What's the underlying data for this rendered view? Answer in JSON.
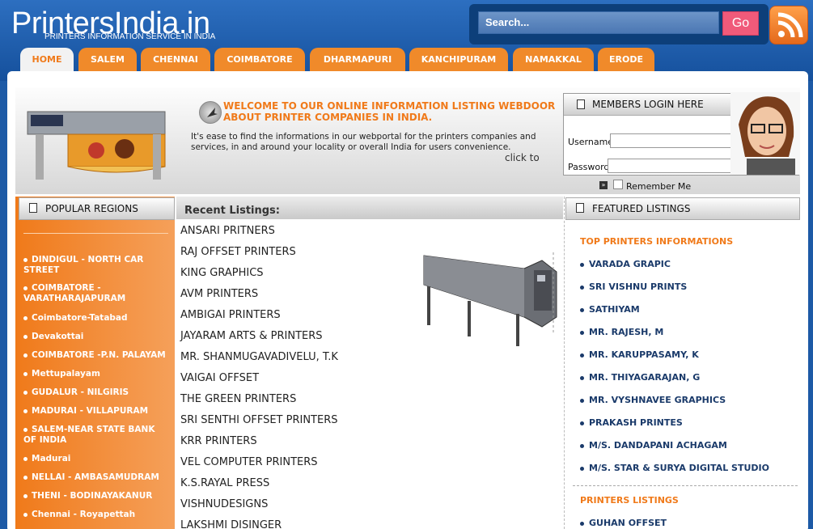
{
  "header": {
    "logo": "PrintersIndia.in",
    "tagline": "PRINTERS INFORMATION SERVICE IN INDIA",
    "search_placeholder": "Search...",
    "go_label": "Go"
  },
  "tabs": [
    {
      "label": "HOME",
      "active": true
    },
    {
      "label": "SALEM"
    },
    {
      "label": "CHENNAI"
    },
    {
      "label": "COIMBATORE"
    },
    {
      "label": "DHARMAPURI"
    },
    {
      "label": "KANCHIPURAM"
    },
    {
      "label": "NAMAKKAL"
    },
    {
      "label": "ERODE"
    }
  ],
  "welcome": {
    "title": "WELCOME TO OUR ONLINE INFORMATION LISTING WEBDOOR ABOUT PRINTER COMPANIES IN INDIA.",
    "text": "It's ease to find the informations in our webportal for the printers companies and services, in and around your locality or overall India for users convenience.",
    "click_to": "click to"
  },
  "login": {
    "title": "MEMBERS LOGIN HERE",
    "username_label": "Username",
    "password_label": "Password",
    "remember_label": "Remember Me"
  },
  "regions": {
    "title": "POPULAR REGIONS",
    "items": [
      "DINDIGUL - NORTH CAR STREET",
      "COIMBATORE - VARATHARAJAPURAM",
      "Coimbatore-Tatabad",
      "Devakottai",
      "COIMBATORE -P.N. PALAYAM",
      "Mettupalayam",
      "GUDALUR - NILGIRIS",
      "MADURAI - VILLAPURAM",
      "SALEM-NEAR STATE BANK OF INDIA",
      "Madurai",
      "NELLAI - AMBASAMUDRAM",
      "THENI - BODINAYAKANUR",
      "Chennai - Royapettah"
    ]
  },
  "recent": {
    "title": "Recent Listings:",
    "items": [
      "ANSARI PRITNERS",
      "RAJ OFFSET PRINTERS",
      "KING GRAPHICS",
      "AVM PRINTERS",
      "AMBIGAI PRINTERS",
      "JAYARAM ARTS & PRINTERS",
      "MR. SHANMUGAVADIVELU, T.K",
      "VAIGAI OFFSET",
      "THE GREEN PRINTERS",
      "SRI SENTHI OFFSET PRINTERS",
      "KRR PRINTERS",
      "VEL COMPUTER PRINTERS",
      "K.S.RAYAL PRESS",
      "VISHNUDESIGNS",
      "LAKSHMI DISINGER"
    ]
  },
  "featured": {
    "title": "FEATURED LISTINGS",
    "top_title": "TOP PRINTERS INFORMATIONS",
    "top_items": [
      "VARADA GRAPIC",
      "SRI VISHNU PRINTS",
      "SATHIYAM",
      "MR. RAJESH, M",
      "MR. KARUPPASAMY, K",
      "MR. THIYAGARAJAN, G",
      "MR. VYSHNAVEE GRAPHICS",
      "PRAKASH PRINTES",
      "M/S. DANDAPANI ACHAGAM",
      "M/S. STAR & SURYA DIGITAL STUDIO"
    ],
    "listings_title": "PRINTERS LISTINGS",
    "listings_items": [
      "GUHAN OFFSET"
    ]
  }
}
